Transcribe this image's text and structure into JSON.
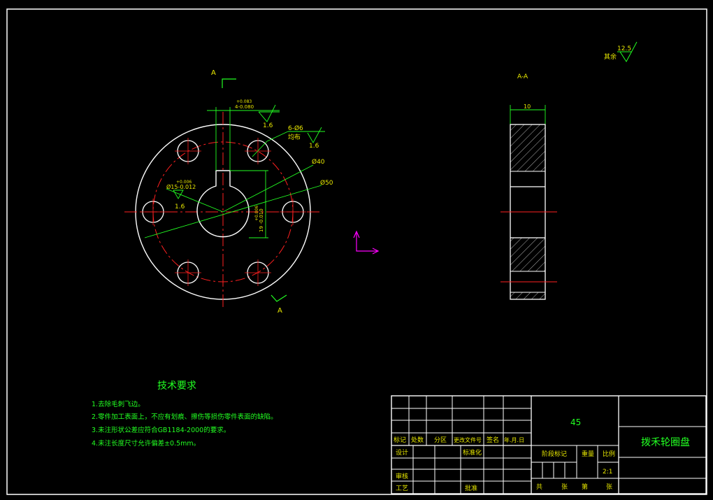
{
  "colors": {
    "background": "#000000",
    "frame": "#ffffff",
    "centerline": "#ff2020",
    "dimension": "#22ff22",
    "text_yellow": "#e8e800",
    "ucs": "#ff00ff"
  },
  "front_view": {
    "section_mark_top": "A",
    "section_mark_bottom": "A",
    "keyway_width_tol": "+0.083\n-0.080",
    "keyway_width": "4",
    "keyway_roughness": "1.6",
    "hole_callout": "6-Ø6",
    "hole_callout_sub": "均布",
    "hole_roughness": "1.6",
    "d40_label": "Ø40",
    "d50_label": "Ø50",
    "bore_label": "Ø15",
    "bore_tol": "+0.006\n-0.012",
    "bore_roughness": "1.6",
    "key_depth_label": "19",
    "key_depth_tol": "+0.006\n-0.010"
  },
  "section_view": {
    "title": "A-A",
    "thickness": "10"
  },
  "roughness_note": {
    "label": "其余",
    "value": "12.5"
  },
  "tech_requirements": {
    "title": "技术要求",
    "items": [
      "1.去除毛刺飞边。",
      "2.零件加工表面上，不应有划痕、擦伤等损伤零件表面的缺陷。",
      "3.未注形状公差应符合GB1184-2000的要求。",
      "4.未注长度尺寸允许偏差±0.5mm。"
    ]
  },
  "title_block": {
    "material": "45",
    "part_name": "拨禾轮圈盘",
    "rev_headers": [
      "标记",
      "处数",
      "分区",
      "更改文件号",
      "签名",
      "年.月.日"
    ],
    "design": "设计",
    "standardize": "标准化",
    "review": "审核",
    "process": "工艺",
    "approve": "批准",
    "stage_mark": "阶段标记",
    "weight": "重量",
    "scale_label": "比例",
    "scale_value": "2:1",
    "total": "共",
    "sheets": "张",
    "page": "第",
    "sheet2": "张"
  }
}
